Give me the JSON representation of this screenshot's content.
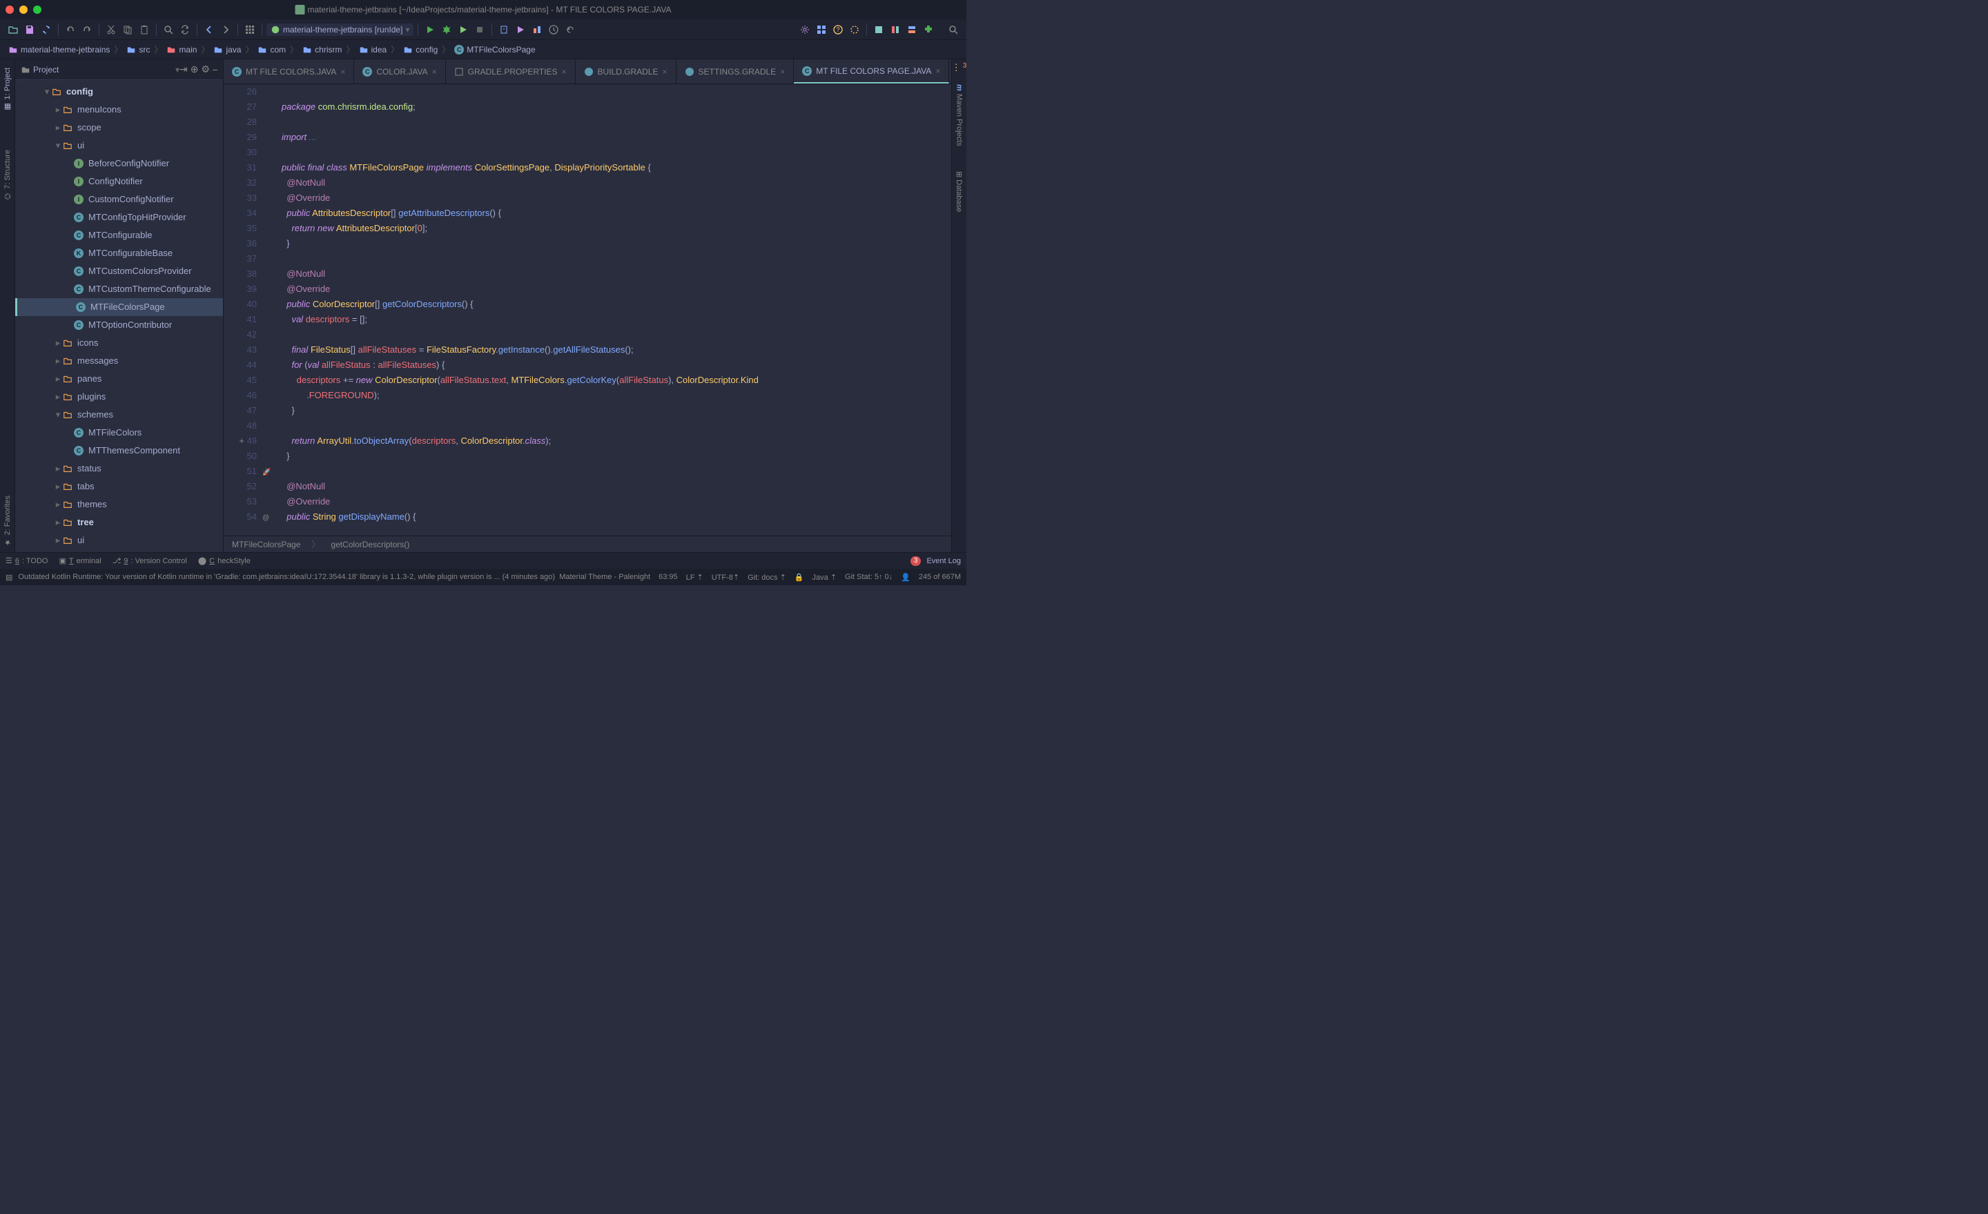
{
  "window": {
    "title": "material-theme-jetbrains [~/IdeaProjects/material-theme-jetbrains] - MT FILE COLORS PAGE.JAVA"
  },
  "toolbar": {
    "run_config": "material-theme-jetbrains [runIde]"
  },
  "breadcrumbs": [
    {
      "label": "material-theme-jetbrains",
      "type": "folder-root"
    },
    {
      "label": "src",
      "type": "folder"
    },
    {
      "label": "main",
      "type": "folder-source"
    },
    {
      "label": "java",
      "type": "folder"
    },
    {
      "label": "com",
      "type": "folder"
    },
    {
      "label": "chrisrm",
      "type": "folder"
    },
    {
      "label": "idea",
      "type": "folder"
    },
    {
      "label": "config",
      "type": "folder"
    },
    {
      "label": "MTFileColorsPage",
      "type": "class"
    }
  ],
  "project_panel": {
    "title": "Project"
  },
  "left_tabs": [
    {
      "label": "1: Project",
      "active": true
    },
    {
      "label": "7: Structure",
      "active": false
    },
    {
      "label": "2: Favorites",
      "active": false
    }
  ],
  "right_tabs": [
    {
      "label": "Maven Projects"
    },
    {
      "label": "Database"
    }
  ],
  "tree": [
    {
      "indent": 0,
      "arrow": "down",
      "icon": "folder",
      "label": "config",
      "bold": true
    },
    {
      "indent": 1,
      "arrow": "right",
      "icon": "folder",
      "label": "menuIcons"
    },
    {
      "indent": 1,
      "arrow": "right",
      "icon": "folder",
      "label": "scope"
    },
    {
      "indent": 1,
      "arrow": "down",
      "icon": "folder",
      "label": "ui"
    },
    {
      "indent": 2,
      "arrow": "",
      "icon": "interface",
      "label": "BeforeConfigNotifier"
    },
    {
      "indent": 2,
      "arrow": "",
      "icon": "interface",
      "label": "ConfigNotifier"
    },
    {
      "indent": 2,
      "arrow": "",
      "icon": "interface",
      "label": "CustomConfigNotifier"
    },
    {
      "indent": 2,
      "arrow": "",
      "icon": "class",
      "label": "MTConfigTopHitProvider"
    },
    {
      "indent": 2,
      "arrow": "",
      "icon": "class",
      "label": "MTConfigurable"
    },
    {
      "indent": 2,
      "arrow": "",
      "icon": "class-k",
      "label": "MTConfigurableBase"
    },
    {
      "indent": 2,
      "arrow": "",
      "icon": "class",
      "label": "MTCustomColorsProvider"
    },
    {
      "indent": 2,
      "arrow": "",
      "icon": "class",
      "label": "MTCustomThemeConfigurable"
    },
    {
      "indent": 2,
      "arrow": "",
      "icon": "class",
      "label": "MTFileColorsPage",
      "selected": true
    },
    {
      "indent": 2,
      "arrow": "",
      "icon": "class",
      "label": "MTOptionContributor"
    },
    {
      "indent": 1,
      "arrow": "right",
      "icon": "folder",
      "label": "icons"
    },
    {
      "indent": 1,
      "arrow": "right",
      "icon": "folder",
      "label": "messages"
    },
    {
      "indent": 1,
      "arrow": "right",
      "icon": "folder",
      "label": "panes"
    },
    {
      "indent": 1,
      "arrow": "right",
      "icon": "folder",
      "label": "plugins"
    },
    {
      "indent": 1,
      "arrow": "down",
      "icon": "folder",
      "label": "schemes"
    },
    {
      "indent": 2,
      "arrow": "",
      "icon": "class",
      "label": "MTFileColors"
    },
    {
      "indent": 2,
      "arrow": "",
      "icon": "class",
      "label": "MTThemesComponent"
    },
    {
      "indent": 1,
      "arrow": "right",
      "icon": "folder",
      "label": "status"
    },
    {
      "indent": 1,
      "arrow": "right",
      "icon": "folder",
      "label": "tabs"
    },
    {
      "indent": 1,
      "arrow": "right",
      "icon": "folder",
      "label": "themes"
    },
    {
      "indent": 1,
      "arrow": "right",
      "icon": "folder",
      "label": "tree",
      "bold": true
    },
    {
      "indent": 1,
      "arrow": "right",
      "icon": "folder",
      "label": "ui"
    }
  ],
  "tabs": [
    {
      "label": "MT FILE COLORS.JAVA",
      "icon": "class"
    },
    {
      "label": "COLOR.JAVA",
      "icon": "class"
    },
    {
      "label": "GRADLE.PROPERTIES",
      "icon": "props"
    },
    {
      "label": "BUILD.GRADLE",
      "icon": "gradle"
    },
    {
      "label": "SETTINGS.GRADLE",
      "icon": "gradle"
    },
    {
      "label": "MT FILE COLORS PAGE.JAVA",
      "icon": "class",
      "active": true
    }
  ],
  "editor": {
    "first_line": 26,
    "lines": [
      "",
      "package com.chrisrm.idea.config;",
      "",
      "import ...",
      "",
      "public final class MTFileColorsPage implements ColorSettingsPage, DisplayPrioritySortable {",
      "  @NotNull",
      "  @Override",
      "  public AttributesDescriptor[] getAttributeDescriptors() {",
      "    return new AttributesDescriptor[0];",
      "  }",
      "",
      "  @NotNull",
      "  @Override",
      "  public ColorDescriptor[] getColorDescriptors() {",
      "    val descriptors = [];",
      "",
      "    final FileStatus[] allFileStatuses = FileStatusFactory.getInstance().getAllFileStatuses();",
      "    for (val allFileStatus : allFileStatuses) {",
      "      descriptors += new ColorDescriptor(allFileStatus.text, MTFileColors.getColorKey(allFileStatus), ColorDescriptor.Kind",
      "          .FOREGROUND);",
      "    }",
      "",
      "    return ArrayUtil.toObjectArray(descriptors, ColorDescriptor.class);",
      "  }",
      "",
      "  @NotNull",
      "  @Override",
      "  public String getDisplayName() {"
    ],
    "highlighted_line": 63,
    "crumbs": [
      "MTFileColorsPage",
      "getColorDescriptors()"
    ]
  },
  "bottom_tabs": [
    {
      "icon": "todo",
      "label": "6: TODO"
    },
    {
      "icon": "terminal",
      "label": "Terminal"
    },
    {
      "icon": "vcs",
      "label": "9: Version Control"
    },
    {
      "icon": "check",
      "label": "CheckStyle"
    }
  ],
  "event_log": {
    "count": "3",
    "label": "Event Log"
  },
  "status": {
    "message": "Outdated Kotlin Runtime: Your version of Kotlin runtime in 'Gradle: com.jetbrains:ideaIU:172.3544.18' library is 1.1.3-2, while plugin version is ... (4 minutes ago)",
    "theme": "Material Theme - Palenight",
    "cursor": "63:95",
    "line_sep": "LF",
    "encoding": "UTF-8",
    "git": "Git: docs",
    "lang": "Java",
    "git_stat": "Git Stat: 5↑ 0↓",
    "memory": "245 of 667M"
  }
}
